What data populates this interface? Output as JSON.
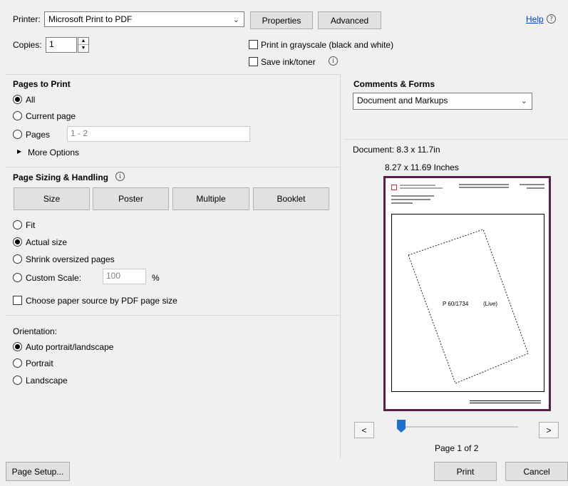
{
  "printer": {
    "label": "Printer:",
    "value": "Microsoft Print to PDF",
    "properties": "Properties",
    "advanced": "Advanced",
    "help": "Help"
  },
  "copies": {
    "label": "Copies:",
    "value": "1"
  },
  "options": {
    "grayscale": "Print in grayscale (black and white)",
    "save_ink": "Save ink/toner"
  },
  "pages_to_print": {
    "title": "Pages to Print",
    "all": "All",
    "current": "Current page",
    "pages": "Pages",
    "pages_value": "1 - 2",
    "more": "More Options"
  },
  "sizing": {
    "title": "Page Sizing & Handling",
    "tabs": [
      "Size",
      "Poster",
      "Multiple",
      "Booklet"
    ],
    "fit": "Fit",
    "actual": "Actual size",
    "shrink": "Shrink oversized pages",
    "custom": "Custom Scale:",
    "custom_value": "100",
    "percent": "%",
    "paper_source": "Choose paper source by PDF page size"
  },
  "orientation": {
    "title": "Orientation:",
    "auto": "Auto portrait/landscape",
    "portrait": "Portrait",
    "landscape": "Landscape"
  },
  "comments": {
    "title": "Comments & Forms",
    "value": "Document and Markups"
  },
  "preview": {
    "document": "Document: 8.3 x 11.7in",
    "dims": "8.27 x 11.69 Inches",
    "label": "P 60/1734",
    "status": "(Live)",
    "page": "Page 1 of 2",
    "prev": "<",
    "next": ">"
  },
  "footer": {
    "page_setup": "Page Setup...",
    "print": "Print",
    "cancel": "Cancel"
  }
}
